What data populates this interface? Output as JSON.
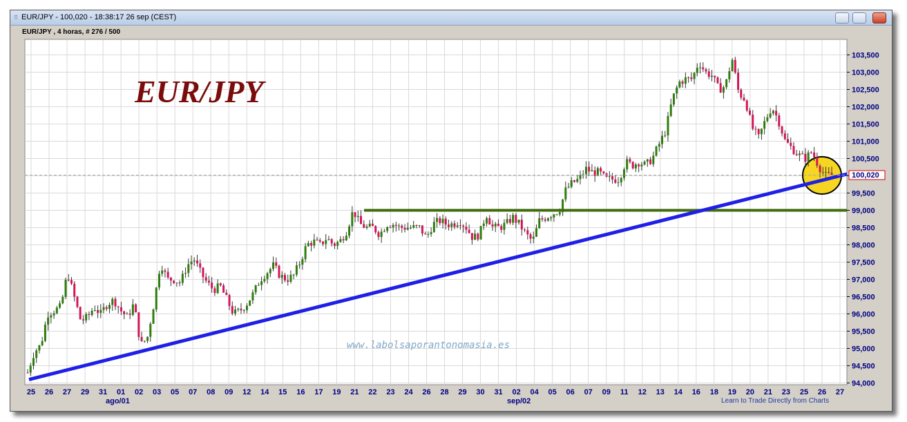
{
  "window": {
    "title": "EUR/JPY - 100,020 - 18:38:17  26 sep (CEST)",
    "subtitle": "EUR/JPY , 4 horas, # 276 / 500"
  },
  "watermark": "www.labolsaporantonomasia.es",
  "footer_link": "Learn to Trade Directly from Charts",
  "colors": {
    "up_candle": "#2e7d0c",
    "down_candle": "#d4145a",
    "trendline": "#1f1fe6",
    "support": "#3f6b0d",
    "highlight": "#f5d20a",
    "title": "#7a0c0c",
    "axis_text": "#000080"
  },
  "chart_data": {
    "type": "candlestick",
    "title": "EUR/JPY",
    "ylim": [
      93.95,
      103.95
    ],
    "y_ticks": [
      "94,000",
      "94,500",
      "95,000",
      "95,500",
      "96,000",
      "96,500",
      "97,000",
      "97,500",
      "98,000",
      "98,500",
      "99,000",
      "99,500",
      "100,000",
      "100,500",
      "101,000",
      "101,500",
      "102,000",
      "102,500",
      "103,000",
      "103,500"
    ],
    "y_tick_values": [
      94.0,
      94.5,
      95.0,
      95.5,
      96.0,
      96.5,
      97.0,
      97.5,
      98.0,
      98.5,
      99.0,
      99.5,
      100.0,
      100.5,
      101.0,
      101.5,
      102.0,
      102.5,
      103.0,
      103.5
    ],
    "x_ticks": [
      "25",
      "26",
      "27",
      "29",
      "31",
      "01",
      "02",
      "03",
      "05",
      "07",
      "08",
      "09",
      "12",
      "14",
      "15",
      "16",
      "17",
      "19",
      "21",
      "22",
      "23",
      "24",
      "26",
      "28",
      "29",
      "30",
      "31",
      "02",
      "04",
      "05",
      "06",
      "07",
      "09",
      "11",
      "12",
      "13",
      "14",
      "16",
      "18",
      "19",
      "20",
      "21",
      "23",
      "25",
      "26",
      "27"
    ],
    "month_labels": [
      "ago/01",
      "sep/02"
    ],
    "last_price_label": "100,020",
    "last_price": 100.02,
    "support_level": 99.0,
    "trendline": {
      "start": 94.1,
      "end": 100.05
    },
    "path_points": [
      [
        0,
        94.3
      ],
      [
        10,
        94.9
      ],
      [
        20,
        95.1
      ],
      [
        30,
        96.0
      ],
      [
        40,
        96.1
      ],
      [
        50,
        96.2
      ],
      [
        60,
        97.2
      ],
      [
        70,
        96.5
      ],
      [
        80,
        95.8
      ],
      [
        90,
        95.9
      ],
      [
        100,
        96.2
      ],
      [
        110,
        96.0
      ],
      [
        120,
        96.3
      ],
      [
        130,
        96.4
      ],
      [
        140,
        96.1
      ],
      [
        150,
        95.9
      ],
      [
        160,
        96.3
      ],
      [
        170,
        95.1
      ],
      [
        180,
        95.3
      ],
      [
        190,
        96.3
      ],
      [
        200,
        97.5
      ],
      [
        210,
        97.0
      ],
      [
        220,
        97.0
      ],
      [
        230,
        96.9
      ],
      [
        240,
        97.4
      ],
      [
        250,
        97.6
      ],
      [
        260,
        97.2
      ],
      [
        270,
        96.9
      ],
      [
        280,
        96.7
      ],
      [
        290,
        96.8
      ],
      [
        300,
        96.4
      ],
      [
        310,
        96.0
      ],
      [
        320,
        96.1
      ],
      [
        330,
        96.3
      ],
      [
        340,
        96.6
      ],
      [
        350,
        97.0
      ],
      [
        360,
        97.2
      ],
      [
        370,
        97.4
      ],
      [
        380,
        97.1
      ],
      [
        390,
        97.0
      ],
      [
        400,
        97.1
      ],
      [
        410,
        97.5
      ],
      [
        420,
        98.0
      ],
      [
        430,
        98.1
      ],
      [
        440,
        98.0
      ],
      [
        450,
        98.2
      ],
      [
        460,
        98.0
      ],
      [
        470,
        98.1
      ],
      [
        480,
        98.4
      ],
      [
        490,
        99.0
      ],
      [
        500,
        98.6
      ],
      [
        510,
        98.5
      ],
      [
        520,
        98.5
      ],
      [
        530,
        98.3
      ],
      [
        540,
        98.6
      ],
      [
        550,
        98.6
      ],
      [
        560,
        98.5
      ],
      [
        570,
        98.5
      ],
      [
        580,
        98.5
      ],
      [
        590,
        98.5
      ],
      [
        600,
        98.2
      ],
      [
        610,
        98.6
      ],
      [
        620,
        98.7
      ],
      [
        630,
        98.6
      ],
      [
        640,
        98.6
      ],
      [
        650,
        98.7
      ],
      [
        660,
        98.5
      ],
      [
        670,
        98.2
      ],
      [
        680,
        98.3
      ],
      [
        690,
        98.9
      ],
      [
        700,
        98.5
      ],
      [
        710,
        98.5
      ],
      [
        720,
        98.6
      ],
      [
        730,
        98.8
      ],
      [
        740,
        98.6
      ],
      [
        750,
        98.3
      ],
      [
        760,
        98.1
      ],
      [
        770,
        98.7
      ],
      [
        780,
        98.8
      ],
      [
        790,
        98.9
      ],
      [
        800,
        99.0
      ],
      [
        810,
        99.6
      ],
      [
        820,
        99.8
      ],
      [
        830,
        99.9
      ],
      [
        840,
        100.2
      ],
      [
        850,
        100.1
      ],
      [
        860,
        100.1
      ],
      [
        870,
        99.9
      ],
      [
        880,
        99.9
      ],
      [
        890,
        99.9
      ],
      [
        900,
        100.4
      ],
      [
        910,
        100.3
      ],
      [
        920,
        100.4
      ],
      [
        930,
        100.3
      ],
      [
        940,
        100.5
      ],
      [
        950,
        100.9
      ],
      [
        960,
        101.3
      ],
      [
        970,
        102.2
      ],
      [
        980,
        102.7
      ],
      [
        990,
        102.8
      ],
      [
        1000,
        102.8
      ],
      [
        1010,
        103.3
      ],
      [
        1020,
        103.0
      ],
      [
        1030,
        102.9
      ],
      [
        1040,
        102.5
      ],
      [
        1050,
        102.6
      ],
      [
        1060,
        103.4
      ],
      [
        1070,
        102.4
      ],
      [
        1080,
        102.2
      ],
      [
        1090,
        101.4
      ],
      [
        1100,
        101.1
      ],
      [
        1110,
        101.6
      ],
      [
        1120,
        102.0
      ],
      [
        1130,
        101.6
      ],
      [
        1140,
        101.0
      ],
      [
        1150,
        100.8
      ],
      [
        1160,
        100.6
      ],
      [
        1170,
        100.5
      ],
      [
        1180,
        100.7
      ],
      [
        1190,
        100.3
      ],
      [
        1200,
        100.0
      ],
      [
        1210,
        100.02
      ]
    ]
  }
}
